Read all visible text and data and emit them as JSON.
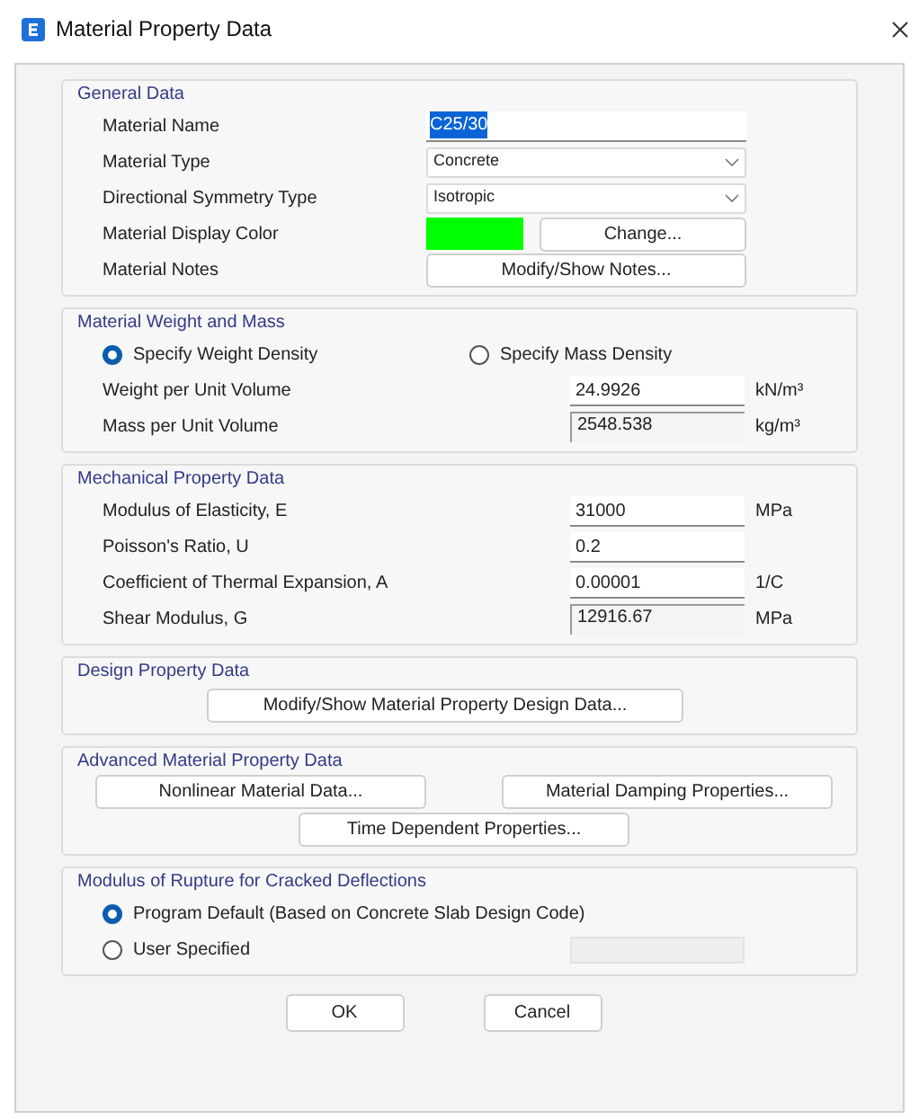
{
  "window": {
    "title": "Material Property Data"
  },
  "general_data": {
    "title": "General Data",
    "rows": [
      {
        "kind": "text",
        "label": "Material Name",
        "value": "C25/30",
        "highlighted": true
      },
      {
        "kind": "dropdown",
        "label": "Material Type",
        "value": "Concrete"
      },
      {
        "kind": "dropdown",
        "label": "Directional Symmetry Type",
        "value": "Isotropic"
      },
      {
        "kind": "color",
        "label": "Material Display Color",
        "color": "#00ff00",
        "button": "Change..."
      },
      {
        "kind": "button",
        "label": "Material Notes",
        "button": "Modify/Show Notes..."
      }
    ]
  },
  "weight_and_mass": {
    "title": "Material Weight and Mass",
    "options": [
      {
        "label": "Specify Weight Density",
        "selected": true
      },
      {
        "label": "Specify Mass Density",
        "selected": false
      }
    ],
    "rows": [
      {
        "label": "Weight per Unit Volume",
        "value": "24.9926",
        "unit": "kN/m³",
        "disabled": false
      },
      {
        "label": "Mass per Unit Volume",
        "value": "2548.538",
        "unit": "kg/m³",
        "disabled": true
      }
    ]
  },
  "mechanical_property_data": {
    "title": "Mechanical Property Data",
    "rows": [
      {
        "label": "Modulus of Elasticity,  E",
        "value": "31000",
        "unit": "MPa",
        "disabled": false
      },
      {
        "label": "Poisson's Ratio,  U",
        "value": "0.2",
        "disabled": false
      },
      {
        "label": "Coefficient of Thermal Expansion,  A",
        "value": "0.00001",
        "unit": "1/C",
        "disabled": false
      },
      {
        "label": "Shear Modulus,  G",
        "value": "12916.67",
        "unit": "MPa",
        "disabled": true
      }
    ]
  },
  "design_property_data": {
    "title": "Design Property Data",
    "buttons": [
      "Modify/Show Material Property Design Data..."
    ]
  },
  "advanced_material_property_data": {
    "title": "Advanced Material Property Data",
    "buttons": [
      "Nonlinear Material Data...",
      "Material Damping Properties...",
      "Time Dependent Properties..."
    ]
  },
  "modulus_of_rupture": {
    "title": "Modulus of Rupture for Cracked Deflections",
    "options": [
      {
        "label": "Program Default  (Based on Concrete Slab Design Code)",
        "selected": true
      },
      {
        "label": "User Specified",
        "selected": false,
        "input_disabled": true
      }
    ]
  },
  "buttons": [
    "OK",
    "Cancel"
  ]
}
